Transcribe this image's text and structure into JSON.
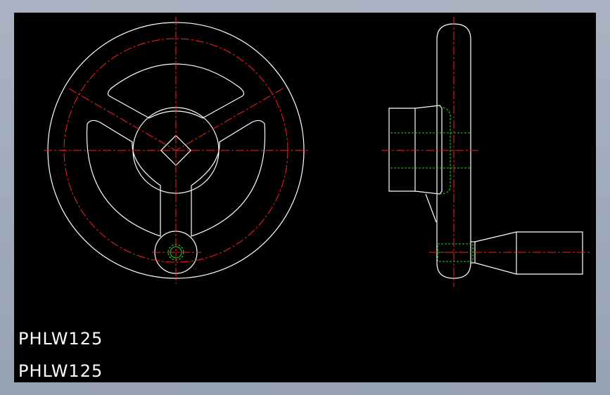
{
  "drawing": {
    "labels": [
      "PHLW125",
      "PHLW125"
    ],
    "colors": {
      "background": "#000000",
      "outline": "#ffffff",
      "centerline": "#ff2020",
      "hidden": "#22cc22",
      "window": "#a3adbc"
    }
  }
}
